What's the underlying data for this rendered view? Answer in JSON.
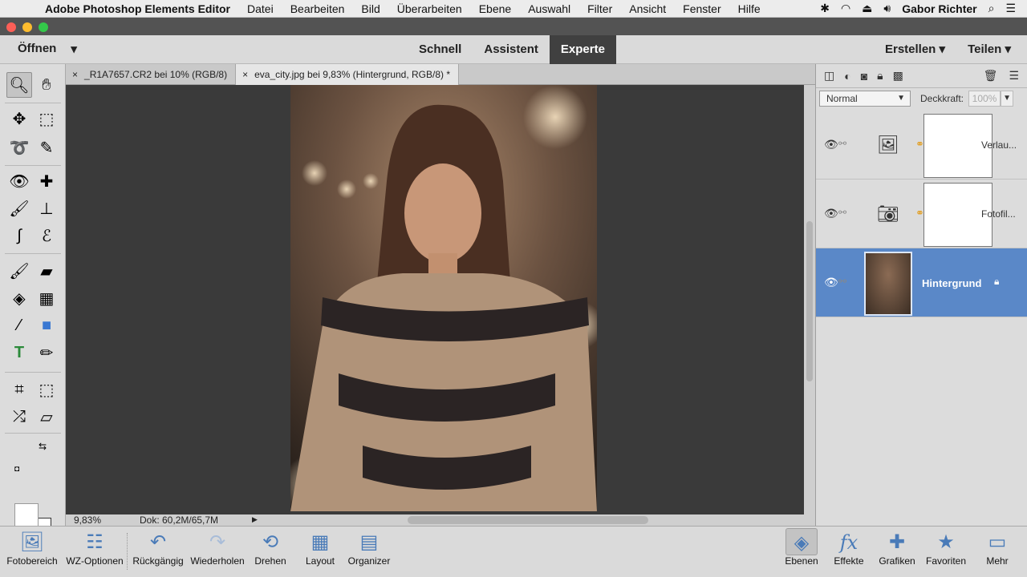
{
  "menubar": {
    "app_name": "Adobe Photoshop Elements Editor",
    "items": [
      "Datei",
      "Bearbeiten",
      "Bild",
      "Überarbeiten",
      "Ebene",
      "Auswahl",
      "Filter",
      "Ansicht",
      "Fenster",
      "Hilfe"
    ],
    "user": "Gabor Richter",
    "status_icons": [
      "bluetooth-icon",
      "wifi-icon",
      "eject-icon",
      "volume-icon",
      "search-icon",
      "list-icon"
    ]
  },
  "modebar": {
    "open_label": "Öffnen",
    "tabs": [
      "Schnell",
      "Assistent",
      "Experte"
    ],
    "active_tab": "Experte",
    "create_label": "Erstellen",
    "share_label": "Teilen"
  },
  "doc_tabs": [
    {
      "label": "_R1A7657.CR2 bei 10% (RGB/8)",
      "active": false
    },
    {
      "label": "eva_city.jpg bei 9,83% (Hintergrund, RGB/8) *",
      "active": true
    }
  ],
  "status": {
    "zoom": "9,83%",
    "doc_size": "Dok: 60,2M/65,7M"
  },
  "layers_panel": {
    "blend_mode": "Normal",
    "opacity_label": "Deckkraft:",
    "opacity_value": "100%",
    "layers": [
      {
        "name": "Verlau...",
        "type_icon": "image-icon",
        "selected": false
      },
      {
        "name": "Fotofil...",
        "type_icon": "camera-icon",
        "selected": false
      },
      {
        "name": "Hintergrund",
        "type_icon": "photo-thumbnail",
        "selected": true
      }
    ]
  },
  "taskbar": {
    "left": [
      {
        "label": "Fotobereich",
        "icon": "photo-bin-icon"
      },
      {
        "label": "WZ-Optionen",
        "icon": "tool-options-icon"
      },
      {
        "label": "Rückgängig",
        "icon": "undo-icon"
      },
      {
        "label": "Wiederholen",
        "icon": "redo-icon"
      },
      {
        "label": "Drehen",
        "icon": "rotate-icon"
      },
      {
        "label": "Layout",
        "icon": "layout-icon"
      },
      {
        "label": "Organizer",
        "icon": "organizer-icon"
      }
    ],
    "right": [
      {
        "label": "Ebenen",
        "icon": "layers-icon"
      },
      {
        "label": "Effekte",
        "icon": "fx-icon"
      },
      {
        "label": "Grafiken",
        "icon": "plus-icon"
      },
      {
        "label": "Favoriten",
        "icon": "star-icon"
      },
      {
        "label": "Mehr",
        "icon": "more-icon"
      }
    ]
  },
  "colors": {
    "accent": "#5a88c8",
    "active_tab_bg": "#404040",
    "canvas_bg": "#3a3a3a"
  }
}
